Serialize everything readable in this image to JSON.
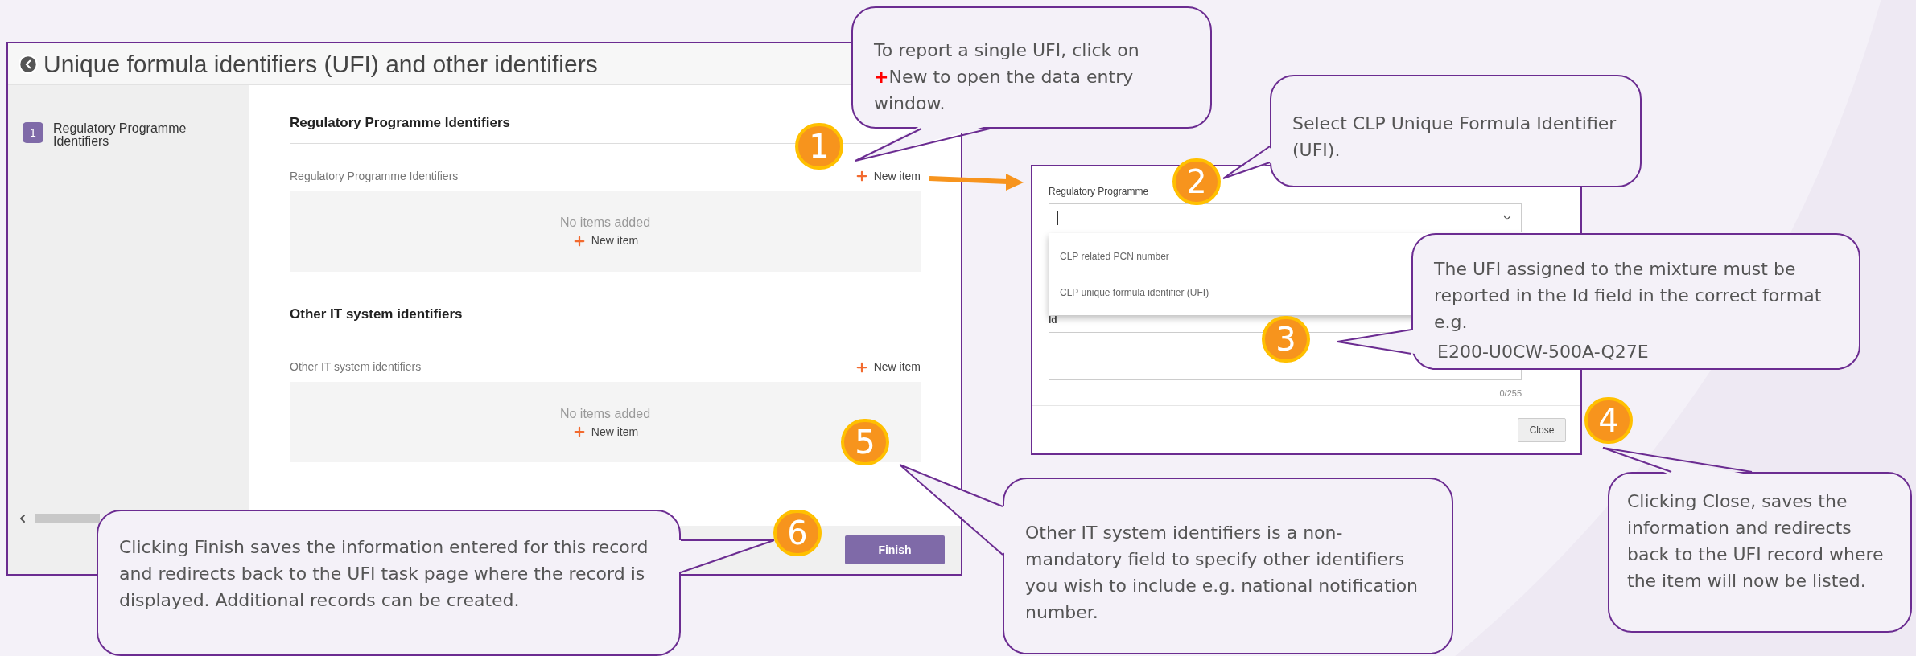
{
  "form_window": {
    "title": "Unique formula identifiers (UFI) and other identifiers",
    "steps": [
      {
        "number": "1",
        "label": "Regulatory Programme Identifiers",
        "selected": true
      }
    ],
    "sections": [
      {
        "heading": "Regulatory Programme Identifiers",
        "list_label": "Regulatory Programme Identifiers",
        "new_item": "New item",
        "empty_text": "No items added",
        "empty_new_item": "New item"
      },
      {
        "heading": "Other IT system identifiers",
        "list_label": "Other IT system identifiers",
        "new_item": "New item",
        "empty_text": "No items added",
        "empty_new_item": "New item"
      }
    ],
    "finish_button": "Finish"
  },
  "dialog": {
    "field_label": "Regulatory Programme",
    "options": [
      "CLP related PCN number",
      "CLP unique formula identifier (UFI)"
    ],
    "id_label": "Id",
    "counter": "0/255",
    "close_button": "Close"
  },
  "markers": [
    "1",
    "2",
    "3",
    "4",
    "5",
    "6"
  ],
  "callouts": [
    {
      "text": "To report a single UFI, click on ",
      "highlight": "+",
      "text_after": "New to open the data entry window."
    },
    {
      "text": "Select CLP Unique Formula Identifier (UFI)."
    },
    {
      "text": "The UFI assigned to the mixture must be reported in the Id field in the correct format e.g.",
      "example": "E200-U0CW-500A-Q27E"
    },
    {
      "text": "Other IT system identifiers is a non-mandatory field to specify other identifiers you wish to include e.g. national notification number."
    },
    {
      "text": "Clicking Close, saves the information and redirects back to the UFI record where the item will now be listed."
    },
    {
      "text": "Clicking Finish saves the information entered for this record and redirects back to the UFI task page where the record is displayed. Additional records can be created."
    }
  ]
}
